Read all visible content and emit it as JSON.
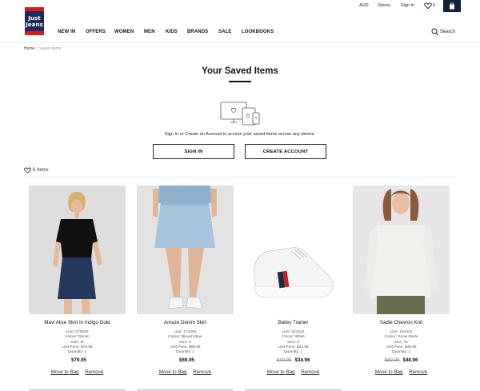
{
  "utility": {
    "currency": "AUD",
    "stores": "Stores",
    "sign_in": "Sign In",
    "wishlist_count": "6"
  },
  "brand": {
    "line1": "Just",
    "line2": "Jeans",
    "colors": {
      "red": "#d71920",
      "navy": "#1b2a5a"
    }
  },
  "nav": {
    "items": [
      "NEW IN",
      "OFFERS",
      "WOMEN",
      "MEN",
      "KIDS",
      "BRANDS",
      "SALE",
      "LOOKBOOKS"
    ],
    "search": "Search"
  },
  "breadcrumb": {
    "home": "Home",
    "separator": "/",
    "current": "Saved Items"
  },
  "page": {
    "title": "Your Saved Items",
    "prompt": "Sign In or Create an Account to access your saved items across any device.",
    "sign_in_button": "SIGN IN",
    "create_account_button": "CREATE ACCOUNT",
    "items_count": "6 Items"
  },
  "products": [
    {
      "name": "Mavi Alice Skirt In Indigo Gold",
      "line": "Line: 070830",
      "colour": "Colour: Denim",
      "size": "Size: M",
      "unit_price": "Unit Price: $79.95",
      "quantity": "Quantity: 1",
      "price_old": "",
      "price": "$79.95",
      "move": "Move to Bag",
      "remove": "Remove"
    },
    {
      "name": "Amaze Denim Skirt",
      "line": "Line: 174255",
      "colour": "Colour: Bleach Blue",
      "size": "Size: 8",
      "unit_price": "Unit Price: $69.95",
      "quantity": "Quantity: 1",
      "price_old": "",
      "price": "$69.95",
      "move": "Move to Bag",
      "remove": "Remove"
    },
    {
      "name": "Bailey Trainer",
      "line": "Line: 221634",
      "colour": "Colour: White",
      "size": "Size: 9",
      "unit_price": "Unit Price: $34.96",
      "quantity": "Quantity: 1",
      "price_old": "$49.95",
      "price": "$34.96",
      "move": "Move to Bag",
      "remove": "Remove"
    },
    {
      "name": "Sadie Chevron Knit",
      "line": "Line: 191424",
      "colour": "Colour: Snow Marle",
      "size": "Size: XL",
      "unit_price": "Unit Price: $48.96",
      "quantity": "Quantity: 1",
      "price_old": "$69.95",
      "price": "$48.96",
      "move": "Move to Bag",
      "remove": "Remove"
    }
  ]
}
